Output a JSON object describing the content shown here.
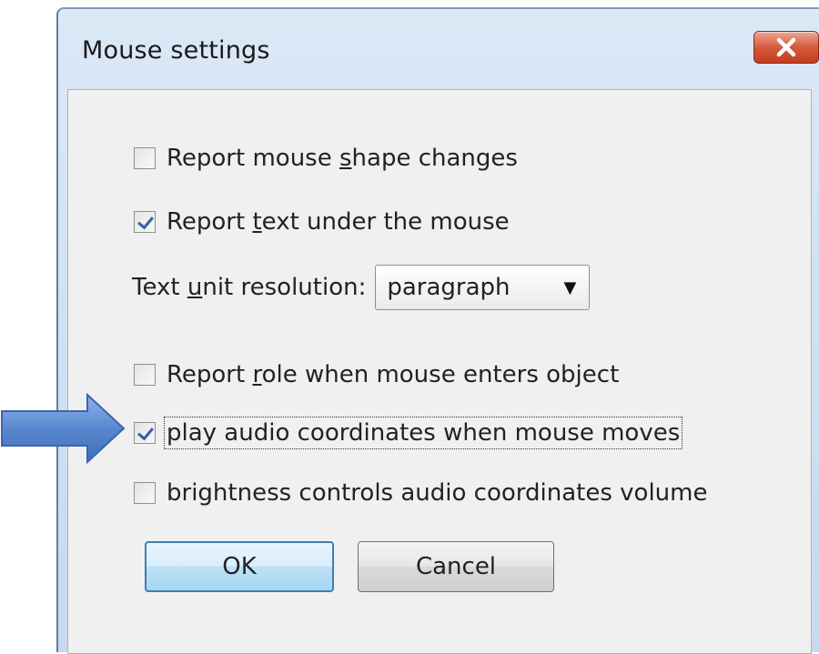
{
  "window": {
    "title": "Mouse settings"
  },
  "options": {
    "shape_changes": {
      "label_pre": "Report mouse ",
      "label_u": "s",
      "label_post": "hape changes",
      "checked": false
    },
    "text_under_mouse": {
      "label_pre": "Report ",
      "label_u": "t",
      "label_post": "ext under the mouse",
      "checked": true
    },
    "text_unit": {
      "label_pre": "Text ",
      "label_u": "u",
      "label_post": "nit resolution:",
      "value": "paragraph"
    },
    "role_enter": {
      "label_pre": "Report ",
      "label_u": "r",
      "label_post": "ole when mouse enters object",
      "checked": false
    },
    "audio_coords": {
      "label": "play audio coordinates when mouse moves",
      "checked": true
    },
    "brightness": {
      "label": "brightness controls audio coordinates volume",
      "checked": false
    }
  },
  "buttons": {
    "ok": "OK",
    "cancel": "Cancel"
  },
  "colors": {
    "arrow": "#4f7fc9",
    "close": "#c23d1f",
    "default_button": "#a6d5f2"
  },
  "icons": {
    "close": "close-icon",
    "dropdown": "chevron-down-icon",
    "pointer_arrow": "right-arrow-icon"
  }
}
